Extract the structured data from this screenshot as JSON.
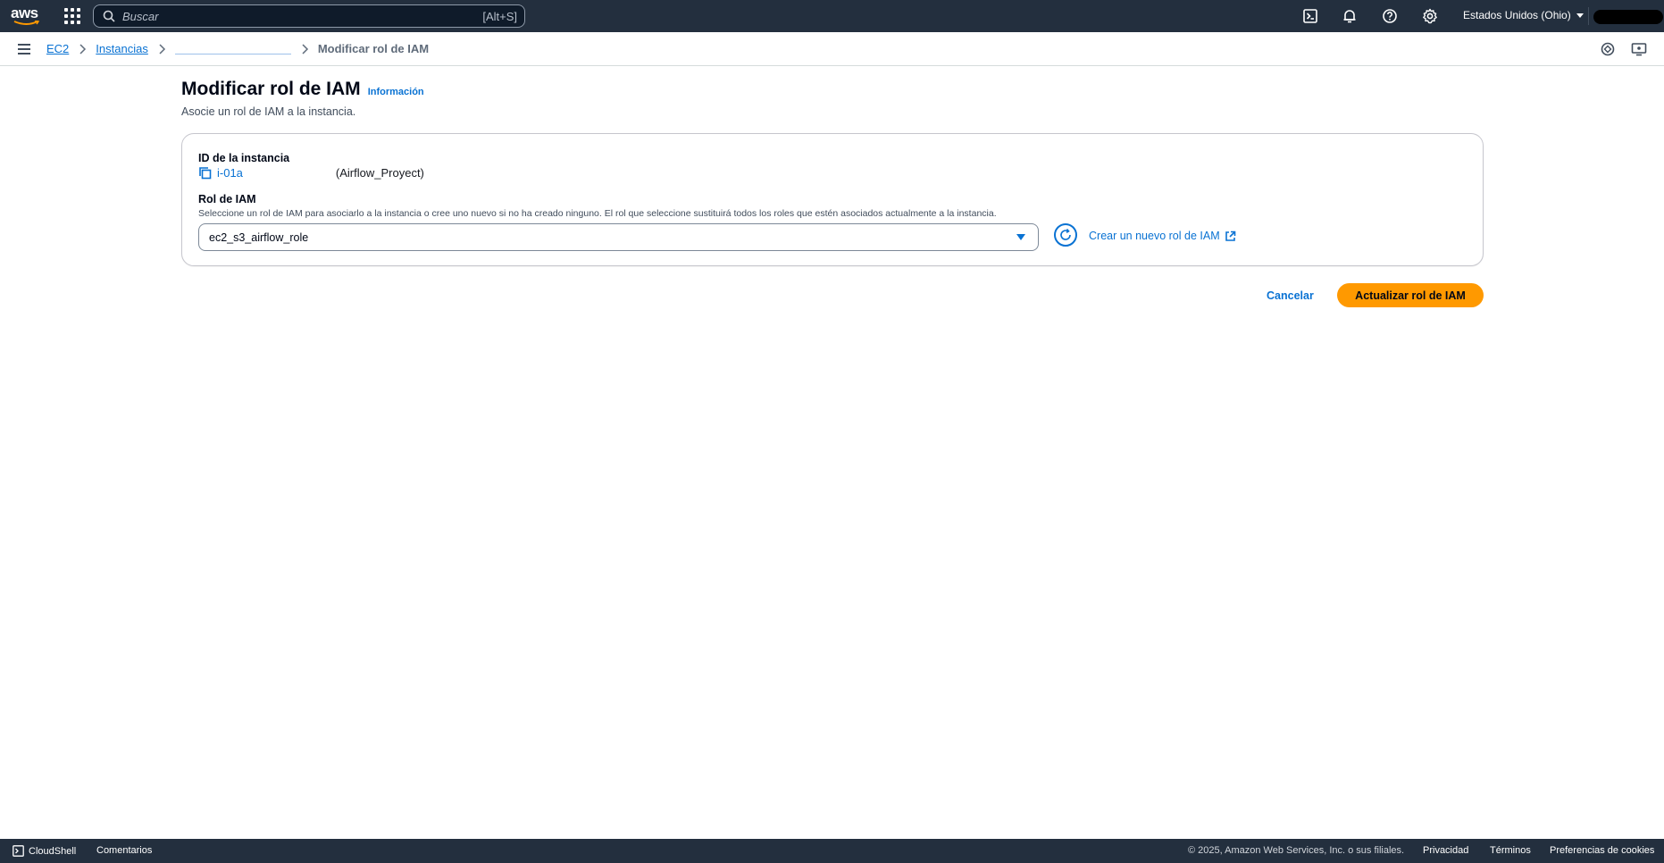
{
  "topnav": {
    "logo_text": "aws",
    "search": {
      "placeholder": "Buscar",
      "shortcut": "[Alt+S]"
    },
    "icons": [
      "cloudshell-icon",
      "bell-icon",
      "help-icon",
      "gear-icon"
    ],
    "region": "Estados Unidos (Ohio)"
  },
  "breadcrumb": {
    "items": [
      {
        "label": "EC2"
      },
      {
        "label": "Instancias"
      }
    ],
    "current": "Modificar rol de IAM"
  },
  "page": {
    "title": "Modificar rol de IAM",
    "info_link": "Información",
    "description": "Asocie un rol de IAM a la instancia."
  },
  "form": {
    "instance_label": "ID de la instancia",
    "instance_id": "i-01a",
    "instance_name": "(Airflow_Proyect)",
    "role_label": "Rol de IAM",
    "role_description": "Seleccione un rol de IAM para asociarlo a la instancia o cree uno nuevo si no ha creado ninguno. El rol que seleccione sustituirá todos los roles que estén asociados actualmente a la instancia.",
    "role_selected": "ec2_s3_airflow_role",
    "create_role_link": "Crear un nuevo rol de IAM"
  },
  "actions": {
    "cancel": "Cancelar",
    "submit": "Actualizar rol de IAM"
  },
  "footer": {
    "cloudshell": "CloudShell",
    "feedback": "Comentarios",
    "copyright": "© 2025, Amazon Web Services, Inc. o sus filiales.",
    "privacy": "Privacidad",
    "terms": "Términos",
    "cookies": "Preferencias de cookies"
  },
  "colors": {
    "nav_bg": "#232f3e",
    "link": "#0972d3",
    "primary_button": "#ff9900"
  }
}
